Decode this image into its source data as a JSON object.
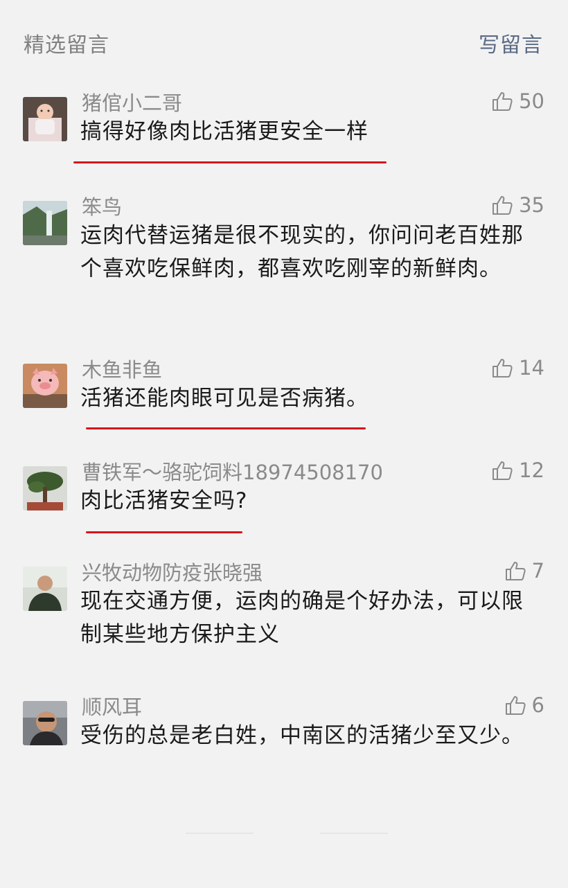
{
  "header": {
    "title": "精选留言",
    "write_label": "写留言"
  },
  "colors": {
    "background": "#f2f2f2",
    "nickname": "#8a8a8a",
    "link": "#5a6a85",
    "underline_red": "#d8141a"
  },
  "comments": [
    {
      "nickname": "猪倌小二哥",
      "likes": "50",
      "text": "搞得好像肉比活猪更安全一样",
      "avatar": "baby-photo",
      "underlined": true
    },
    {
      "nickname": "笨鸟",
      "likes": "35",
      "text": "运肉代替运猪是很不现实的，你问问老百姓那个喜欢吃保鲜肉，都喜欢吃刚宰的新鲜肉。",
      "avatar": "waterfall-landscape",
      "underlined": false
    },
    {
      "nickname": "木鱼非鱼",
      "likes": "14",
      "text": "活猪还能肉眼可见是否病猪。",
      "avatar": "cartoon-pig",
      "underlined": true
    },
    {
      "nickname": "曹铁军～骆驼饲料18974508170",
      "likes": "12",
      "text": "肉比活猪安全吗?",
      "avatar": "bonsai-tree",
      "underlined": true
    },
    {
      "nickname": "兴牧动物防疫张晓强",
      "likes": "7",
      "text": "现在交通方便，运肉的确是个好办法，可以限制某些地方保护主义",
      "avatar": "man-portrait",
      "underlined": false
    },
    {
      "nickname": "顺风耳",
      "likes": "6",
      "text": "受伤的总是老白姓，中南区的活猪少至又少。",
      "avatar": "man-sunglasses",
      "underlined": false
    }
  ]
}
